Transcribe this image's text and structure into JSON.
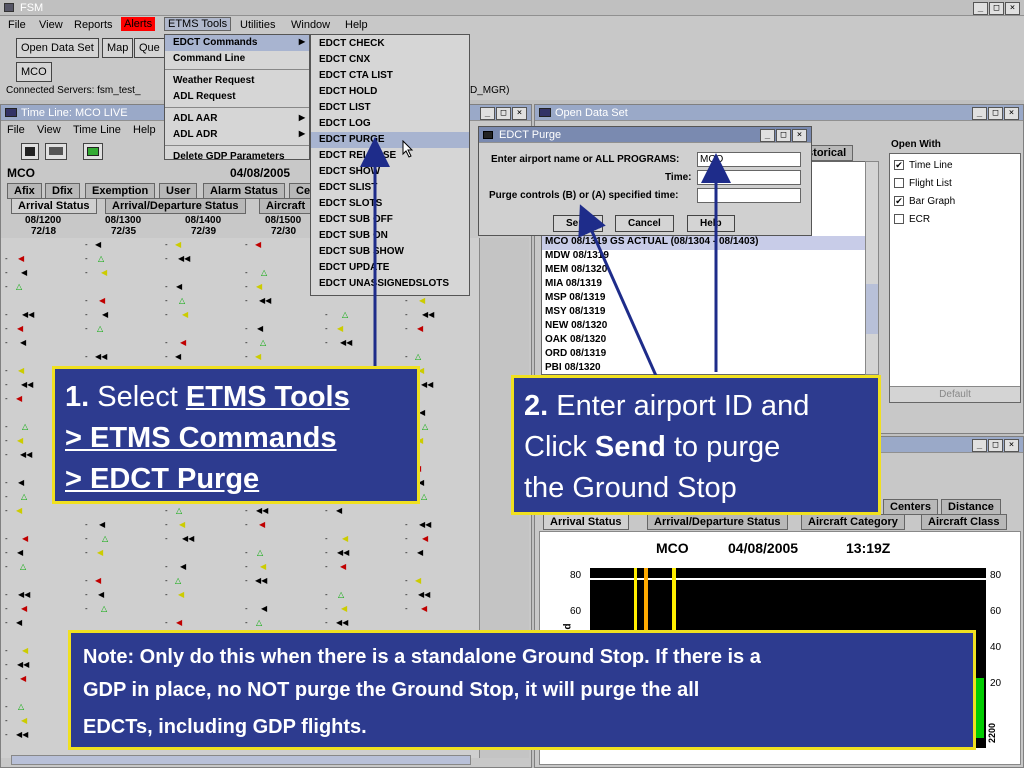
{
  "app": {
    "title": "FSM",
    "menu": [
      "File",
      "View",
      "Reports",
      "Alerts",
      "ETMS Tools",
      "Utilities",
      "Window",
      "Help"
    ],
    "toolbar": {
      "open_data_set": "Open Data Set",
      "map": "Map",
      "query": "Que",
      "mco": "MCO"
    },
    "connected_label": "Connected Servers: fsm_test_",
    "connected_suffix": "D_MGR)"
  },
  "etms_menu": {
    "items": [
      "EDCT Commands",
      "Command Line",
      "Weather Request",
      "ADL Request",
      "ADL AAR",
      "ADL ADR",
      "Delete GDP Parameters"
    ]
  },
  "edct_submenu": {
    "items": [
      "EDCT CHECK",
      "EDCT CNX",
      "EDCT CTA LIST",
      "EDCT HOLD",
      "EDCT LIST",
      "EDCT LOG",
      "EDCT PURGE",
      "EDCT RELEASE",
      "EDCT SHOW",
      "EDCT SLIST",
      "EDCT SLOTS",
      "EDCT SUB OFF",
      "EDCT SUB ON",
      "EDCT SUB SHOW",
      "EDCT UPDATE",
      "EDCT UNASSIGNEDSLOTS"
    ]
  },
  "timeline": {
    "title": "Time Line: MCO LIVE",
    "menu": [
      "File",
      "View",
      "Time Line",
      "Help"
    ],
    "airport": "MCO",
    "date": "04/08/2005",
    "tabs_row1": [
      "Afix",
      "Dfix",
      "Exemption",
      "User",
      "Alarm Status",
      "Ce"
    ],
    "tabs_row2": [
      "Arrival Status",
      "Arrival/Departure Status",
      "Aircraft"
    ],
    "columns": [
      {
        "time": "08/1200",
        "ratio": "72/18"
      },
      {
        "time": "08/1300",
        "ratio": "72/35"
      },
      {
        "time": "08/1400",
        "ratio": "72/39"
      },
      {
        "time": "08/1500",
        "ratio": "72/30"
      }
    ]
  },
  "open_data_set": {
    "title": "Open Data Set",
    "historical_tab": "istorical",
    "open_with_label": "Open With",
    "options": [
      {
        "label": "Time Line",
        "checked": "✔"
      },
      {
        "label": "Flight List",
        "checked": ""
      },
      {
        "label": "Bar Graph",
        "checked": "✔"
      },
      {
        "label": "ECR",
        "checked": ""
      }
    ],
    "default_button": "Default",
    "list": [
      "MCO 08/1319 GS ACTUAL (08/1304 - 08/1403)",
      "MDW 08/1319",
      "MEM 08/1320",
      "MIA 08/1319",
      "MSP 08/1319",
      "MSY 08/1319",
      "NEW 08/1320",
      "OAK 08/1320",
      "ORD 08/1319",
      "PBI 08/1320"
    ]
  },
  "edct_purge_dialog": {
    "title": "EDCT Purge",
    "airport_label": "Enter airport name or ALL PROGRAMS:",
    "airport_value": "MCO",
    "time_label": "Time:",
    "purge_label": "Purge controls (B) or (A) specified time:",
    "send": "Send",
    "cancel": "Cancel",
    "help": "Help"
  },
  "bargraph": {
    "tabs_top": [
      "Centers",
      "Distance"
    ],
    "tabs": [
      "Arrival Status",
      "Arrival/Departure Status",
      "Aircraft Category",
      "Aircraft Class"
    ],
    "airport": "MCO",
    "date": "04/08/2005",
    "time": "13:19Z",
    "y_ticks": [
      "80",
      "60",
      "40",
      "20"
    ],
    "axis_label": "nd",
    "x_tick": "2200"
  },
  "callout1": {
    "num": "1.",
    "text1": "Select",
    "link1": "ETMS Tools",
    "link2": "> ETMS Commands",
    "link3": "> EDCT Purge"
  },
  "callout2": {
    "num": "2.",
    "text1": "Enter airport ID and",
    "text2": "Click",
    "bold": "Send",
    "text3": "to purge",
    "text4": "the Ground Stop"
  },
  "note": {
    "line1": "Note:  Only do this when there is a standalone Ground Stop.  If there is a",
    "line2": "GDP in place, no NOT purge the Ground Stop, it will purge the all",
    "line3": "EDCTs, including GDP flights."
  },
  "colors": {
    "accent": "#2d3b8f",
    "highlight": "#f0e020",
    "alert": "#ff0000"
  }
}
